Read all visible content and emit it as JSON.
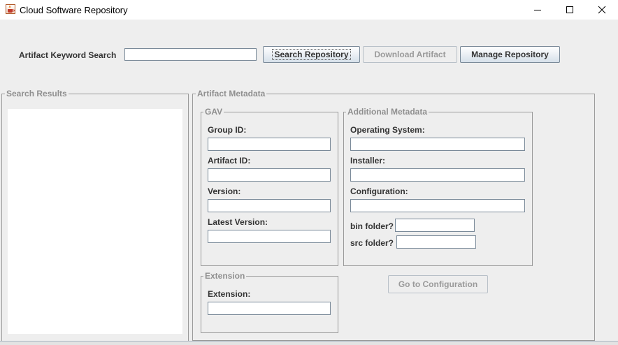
{
  "window": {
    "title": "Cloud Software Repository",
    "icon": "java-cup-icon",
    "controls": [
      "minimize-icon",
      "maximize-icon",
      "close-icon"
    ]
  },
  "search_bar": {
    "label": "Artifact Keyword Search",
    "input_value": "",
    "search_button": "Search Repository",
    "download_button": "Download Artifact",
    "manage_button": "Manage Repository"
  },
  "search_results": {
    "title": "Search Results",
    "items": []
  },
  "metadata": {
    "title": "Artifact Metadata",
    "gav": {
      "title": "GAV",
      "group_id_label": "Group ID:",
      "group_id_value": "",
      "artifact_id_label": "Artifact ID:",
      "artifact_id_value": "",
      "version_label": "Version:",
      "version_value": "",
      "latest_version_label": "Latest Version:",
      "latest_version_value": ""
    },
    "additional": {
      "title": "Additional Metadata",
      "os_label": "Operating System:",
      "os_value": "",
      "installer_label": "Installer:",
      "installer_value": "",
      "configuration_label": "Configuration:",
      "configuration_value": "",
      "bin_folder_label": "bin folder?",
      "bin_folder_value": "",
      "src_folder_label": "src folder?",
      "src_folder_value": ""
    },
    "extension": {
      "title": "Extension",
      "extension_label": "Extension:",
      "extension_value": ""
    },
    "go_to_configuration_button": "Go to Configuration"
  }
}
